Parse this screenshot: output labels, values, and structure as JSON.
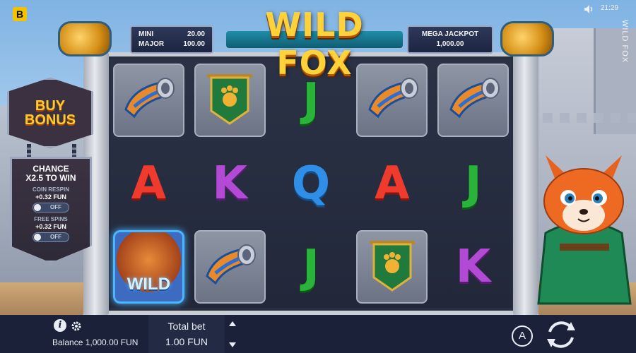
{
  "app": {
    "title": "WILD FOX",
    "vertical_title": "WILD FOX",
    "clock": "21:29",
    "logo_letter": "B"
  },
  "jackpots": {
    "mini_label": "MINI",
    "mini_value": "20.00",
    "major_label": "MAJOR",
    "major_value": "100.00",
    "mega_label": "MEGA JACKPOT",
    "mega_value": "1,000.00"
  },
  "buy_bonus": {
    "line1": "BUY",
    "line2": "BONUS"
  },
  "chance_panel": {
    "title_line1": "CHANCE",
    "title_line2": "X2.5 TO WIN",
    "coin_respin_label": "COIN RESPIN",
    "coin_respin_price": "+0.32 FUN",
    "coin_respin_state": "OFF",
    "free_spins_label": "FREE SPINS",
    "free_spins_price": "+0.32 FUN",
    "free_spins_state": "OFF"
  },
  "reels": {
    "grid": [
      [
        "horn",
        "banner",
        "J",
        "horn",
        "horn"
      ],
      [
        "A",
        "K",
        "Q",
        "A",
        "J"
      ],
      [
        "wild",
        "horn",
        "J",
        "banner",
        "K"
      ]
    ],
    "wild_label": "WILD"
  },
  "bottom_bar": {
    "balance": "Balance 1,000.00 FUN",
    "total_bet_label": "Total bet",
    "total_bet_value": "1.00 FUN",
    "auto_label": "A"
  },
  "colors": {
    "title_gold": "#ffd23a",
    "letter_J": "#29b33a",
    "letter_A": "#ee3b2e",
    "letter_K": "#b34ad6",
    "letter_Q": "#2f8fe6",
    "bar_bg": "#1a2138"
  },
  "icons": [
    "logo-icon",
    "sound-icon",
    "info-icon",
    "gear-icon",
    "arrow-up-icon",
    "arrow-down-icon",
    "autoplay-icon",
    "spin-icon"
  ]
}
